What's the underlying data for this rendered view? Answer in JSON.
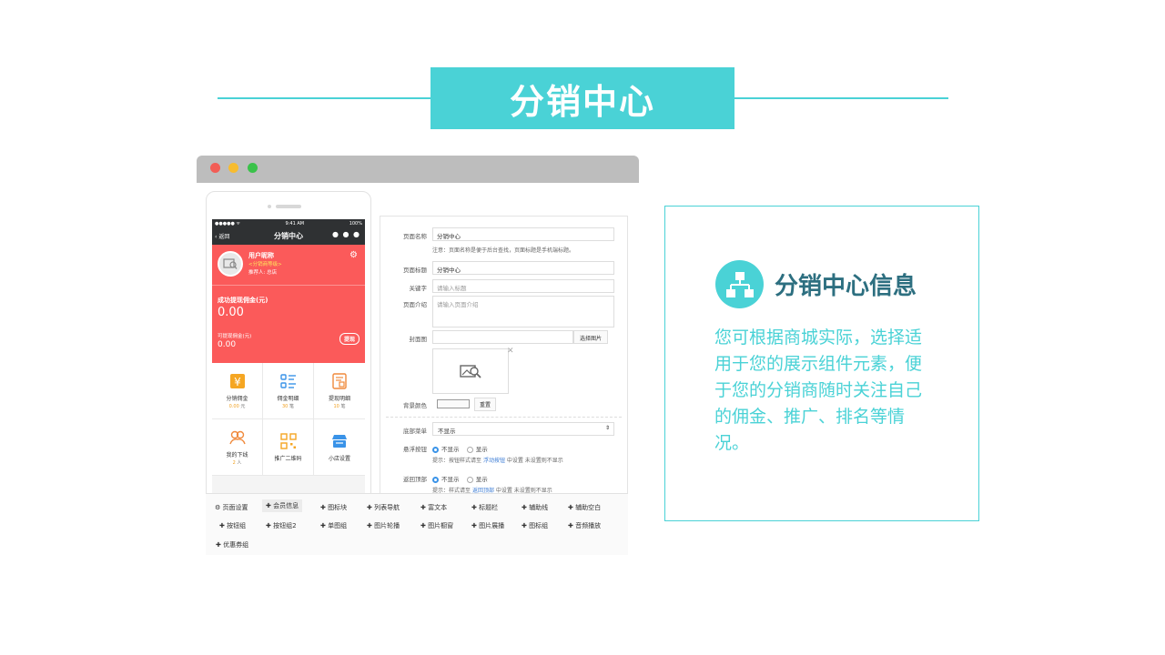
{
  "title": "分销中心",
  "colors": {
    "accent": "#4ad2d6",
    "red": "#fb5a5a",
    "dark": "#2f3133"
  },
  "phone": {
    "status": {
      "signal": "●●●●● ᯤ",
      "time": "9:41 AM",
      "battery": "100%"
    },
    "nav": {
      "back": "返回",
      "title": "分销中心",
      "more": "● ● ●"
    },
    "user": {
      "name": "用户昵称",
      "level": "<分销商等级>",
      "referrer": "推荐人: 总店"
    },
    "income": {
      "label": "成功提现佣金(元)",
      "value": "0.00",
      "withdrawable_label": "可提现佣金(元)",
      "withdrawable_value": "0.00",
      "button": "提现"
    },
    "grid": [
      {
        "icon": "yen-icon",
        "label": "分销佣金",
        "value": "0.00",
        "unit": "元"
      },
      {
        "icon": "list-icon",
        "label": "佣金明细",
        "value": "30",
        "unit": "笔"
      },
      {
        "icon": "document-icon",
        "label": "提现明细",
        "value": "10",
        "unit": "笔"
      },
      {
        "icon": "people-icon",
        "label": "我的下线",
        "value": "2",
        "unit": "人"
      },
      {
        "icon": "qrcode-icon",
        "label": "推广二维码",
        "value": "",
        "unit": ""
      },
      {
        "icon": "shop-icon",
        "label": "小店设置",
        "value": "",
        "unit": ""
      }
    ]
  },
  "form": {
    "page_name": {
      "label": "页面名称",
      "value": "分销中心",
      "hint": "注意：页面名称是便于后台查找，页面标题是手机端标题。"
    },
    "page_title": {
      "label": "页面标题",
      "value": "分销中心"
    },
    "keyword": {
      "label": "关键字",
      "placeholder": "请输入标题"
    },
    "intro": {
      "label": "页面介绍",
      "placeholder": "请输入页面介绍"
    },
    "cover": {
      "label": "封面图",
      "button": "选择图片"
    },
    "bg_color": {
      "label": "背景颜色",
      "button": "重置"
    },
    "bottom_menu": {
      "label": "底部菜单",
      "value": "不显示"
    },
    "float_button": {
      "label": "悬浮按钮",
      "opt_off": "不显示",
      "opt_on": "显示",
      "hint_pre": "提示：按钮样式请至",
      "hint_link": "浮动按钮",
      "hint_post": "中设置 未设置则不显示"
    },
    "back_top": {
      "label": "返回顶部",
      "opt_off": "不显示",
      "opt_on": "显示",
      "hint_pre": "提示：样式请至",
      "hint_link": "返回顶部",
      "hint_post": "中设置 未设置则不显示"
    }
  },
  "toolbar": {
    "row1": [
      "⚙ 页面设置",
      "✚ 会员信息",
      "✚ 图标块",
      "✚ 列表导航",
      "✚ 富文本",
      "✚ 标题栏",
      "✚ 辅助线",
      "✚ 辅助空白"
    ],
    "row2": [
      "✚ 按钮组",
      "✚ 按钮组2",
      "✚ 单图组",
      "✚ 图片轮播",
      "✚ 图片橱窗",
      "✚ 图片展播",
      "✚ 图标组",
      "✚ 音频播放"
    ],
    "row3": [
      "✚ 优惠券组"
    ]
  },
  "card": {
    "title": "分销中心信息",
    "text": "您可根据商城实际，选择适用于您的展示组件元素，便于您的分销商随时关注自己的佣金、推广、排名等情况。"
  }
}
